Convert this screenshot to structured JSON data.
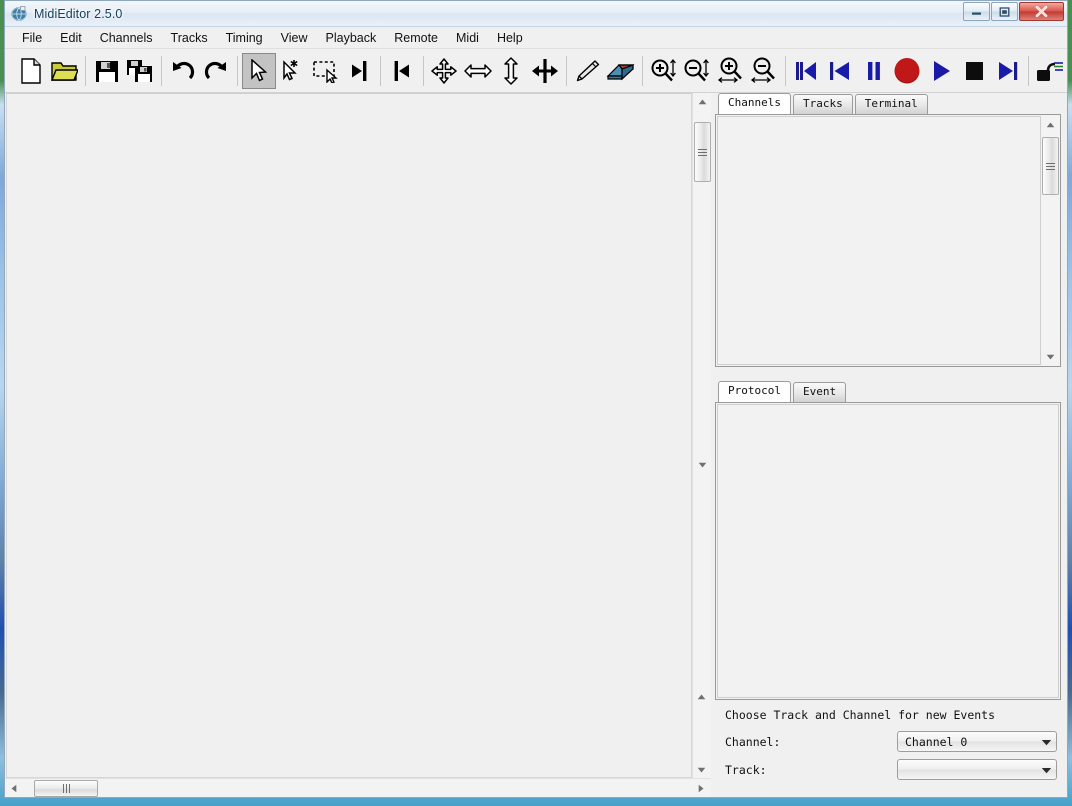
{
  "window": {
    "title": "MidiEditor 2.5.0",
    "icon": "app-globe-icon",
    "buttons": {
      "minimize": "Minimize",
      "maximize": "Maximize",
      "close": "Close"
    }
  },
  "menubar": {
    "items": [
      {
        "label": "File"
      },
      {
        "label": "Edit"
      },
      {
        "label": "Channels"
      },
      {
        "label": "Tracks"
      },
      {
        "label": "Timing"
      },
      {
        "label": "View"
      },
      {
        "label": "Playback"
      },
      {
        "label": "Remote"
      },
      {
        "label": "Midi"
      },
      {
        "label": "Help"
      }
    ]
  },
  "toolbar": {
    "groups": [
      {
        "buttons": [
          {
            "icon": "new-file-icon",
            "label": "New",
            "active": false
          },
          {
            "icon": "open-folder-icon",
            "label": "Open",
            "active": false
          },
          {
            "icon": "save-icon",
            "label": "Save",
            "active": false
          },
          {
            "icon": "save-as-icon",
            "label": "Save As",
            "active": false
          }
        ]
      },
      {
        "buttons": [
          {
            "icon": "undo-icon",
            "label": "Undo",
            "active": false
          },
          {
            "icon": "redo-icon",
            "label": "Redo",
            "active": false
          }
        ]
      },
      {
        "buttons": [
          {
            "icon": "select-cursor-icon",
            "label": "Standard Tool",
            "active": true
          },
          {
            "icon": "select-single-icon",
            "label": "Select single Events",
            "active": false
          },
          {
            "icon": "select-box-icon",
            "label": "Select Box",
            "active": false
          },
          {
            "icon": "select-left-icon",
            "label": "Select left",
            "active": false
          },
          {
            "icon": "select-right-icon",
            "label": "Select right",
            "active": false
          }
        ]
      },
      {
        "buttons": [
          {
            "icon": "move-all-icon",
            "label": "Move Events",
            "active": false
          },
          {
            "icon": "move-horizontal-icon",
            "label": "Move horizontal",
            "active": false
          },
          {
            "icon": "move-vertical-icon",
            "label": "Move vertical",
            "active": false
          },
          {
            "icon": "size-change-icon",
            "label": "Change Size",
            "active": false
          }
        ]
      },
      {
        "buttons": [
          {
            "icon": "pencil-icon",
            "label": "New Note",
            "active": false
          },
          {
            "icon": "eraser-icon",
            "label": "Delete Events",
            "active": false
          }
        ]
      },
      {
        "buttons": [
          {
            "icon": "zoom-in-vertical-icon",
            "label": "Zoom in vertical",
            "active": false
          },
          {
            "icon": "zoom-out-vertical-icon",
            "label": "Zoom out vertical",
            "active": false
          },
          {
            "icon": "zoom-in-horizontal-icon",
            "label": "Zoom in horizontal",
            "active": false
          },
          {
            "icon": "zoom-out-horizontal-icon",
            "label": "Zoom out horizontal",
            "active": false
          }
        ]
      },
      {
        "buttons": [
          {
            "icon": "skip-to-start-icon",
            "label": "Back to begin",
            "active": false
          },
          {
            "icon": "previous-measure-icon",
            "label": "Previous measure",
            "active": false
          },
          {
            "icon": "pause-icon",
            "label": "Pause",
            "active": false
          },
          {
            "icon": "record-icon",
            "label": "Record",
            "active": false
          },
          {
            "icon": "play-icon",
            "label": "Play",
            "active": false
          },
          {
            "icon": "stop-icon",
            "label": "Stop",
            "active": false
          },
          {
            "icon": "next-measure-icon",
            "label": "Next measure",
            "active": false
          }
        ]
      },
      {
        "buttons": [
          {
            "icon": "metronome-icon",
            "label": "Metronome",
            "active": false
          }
        ]
      }
    ]
  },
  "editor": {
    "name": "midi-matrix-area",
    "vertical_scrollbar": {
      "thumb_top_pct": 4,
      "thumb_height_pct": 9
    },
    "secondary_vertical_scrollbar": {
      "thumb_top_pct": 0,
      "thumb_height_pct": 0
    },
    "horizontal_scrollbar": {
      "thumb_left_pct": 4,
      "thumb_width_pct": 10
    }
  },
  "upper_panel": {
    "tabs": [
      {
        "label": "Channels",
        "selected": true
      },
      {
        "label": "Tracks",
        "selected": false
      },
      {
        "label": "Terminal",
        "selected": false
      }
    ],
    "content": "",
    "scrollbar": {
      "thumb_top_pct": 3,
      "thumb_height_pct": 24
    }
  },
  "lower_panel": {
    "tabs": [
      {
        "label": "Protocol",
        "selected": true
      },
      {
        "label": "Event",
        "selected": false
      }
    ],
    "content": ""
  },
  "new_event_form": {
    "title": "Choose Track and Channel for new Events",
    "channel_label": "Channel:",
    "channel_value": "Channel 0",
    "track_label": "Track:",
    "track_value": ""
  },
  "colors": {
    "window_bg": "#f0f0f0",
    "record_red": "#b41818",
    "transport_blue": "#1a1aa8",
    "folder_yellow": "#c8c832",
    "eraser_blue": "#3a7fa8",
    "eraser_red": "#a83232",
    "close_button": "#c03b30"
  }
}
